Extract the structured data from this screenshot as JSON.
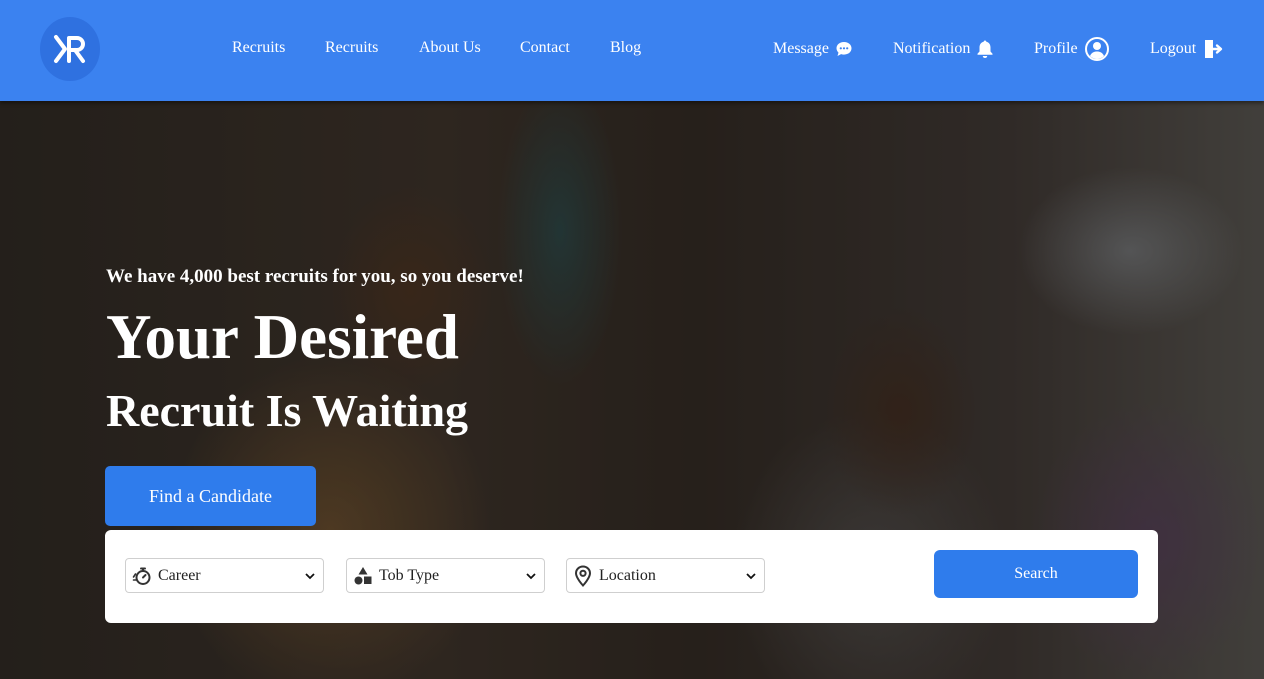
{
  "brand": {
    "logo_icon": "xr-logo-icon",
    "color": "#3b82f0"
  },
  "nav": {
    "links": [
      {
        "label": "Recruits"
      },
      {
        "label": "Recruits"
      },
      {
        "label": "About Us"
      },
      {
        "label": "Contact"
      },
      {
        "label": "Blog"
      }
    ]
  },
  "utility": {
    "message": {
      "label": "Message",
      "icon": "chat-bubble-icon"
    },
    "notification": {
      "label": "Notification",
      "icon": "bell-icon"
    },
    "profile": {
      "label": "Profile",
      "icon": "user-circle-icon"
    },
    "logout": {
      "label": "Logout",
      "icon": "logout-icon"
    }
  },
  "hero": {
    "tagline": "We have 4,000 best recruits for you, so you deserve!",
    "title_line1": "Your Desired",
    "title_line2": "Recruit Is Waiting",
    "cta_label": "Find a Candidate"
  },
  "search": {
    "career": {
      "value": "Career",
      "icon": "stopwatch-icon"
    },
    "job_type": {
      "value": "Tob Type",
      "icon": "shapes-icon"
    },
    "location": {
      "value": "Location",
      "icon": "map-pin-icon"
    },
    "button_label": "Search"
  },
  "colors": {
    "header": "#3b82f0",
    "accent_button": "#2f7cec",
    "panel": "#ffffff"
  }
}
